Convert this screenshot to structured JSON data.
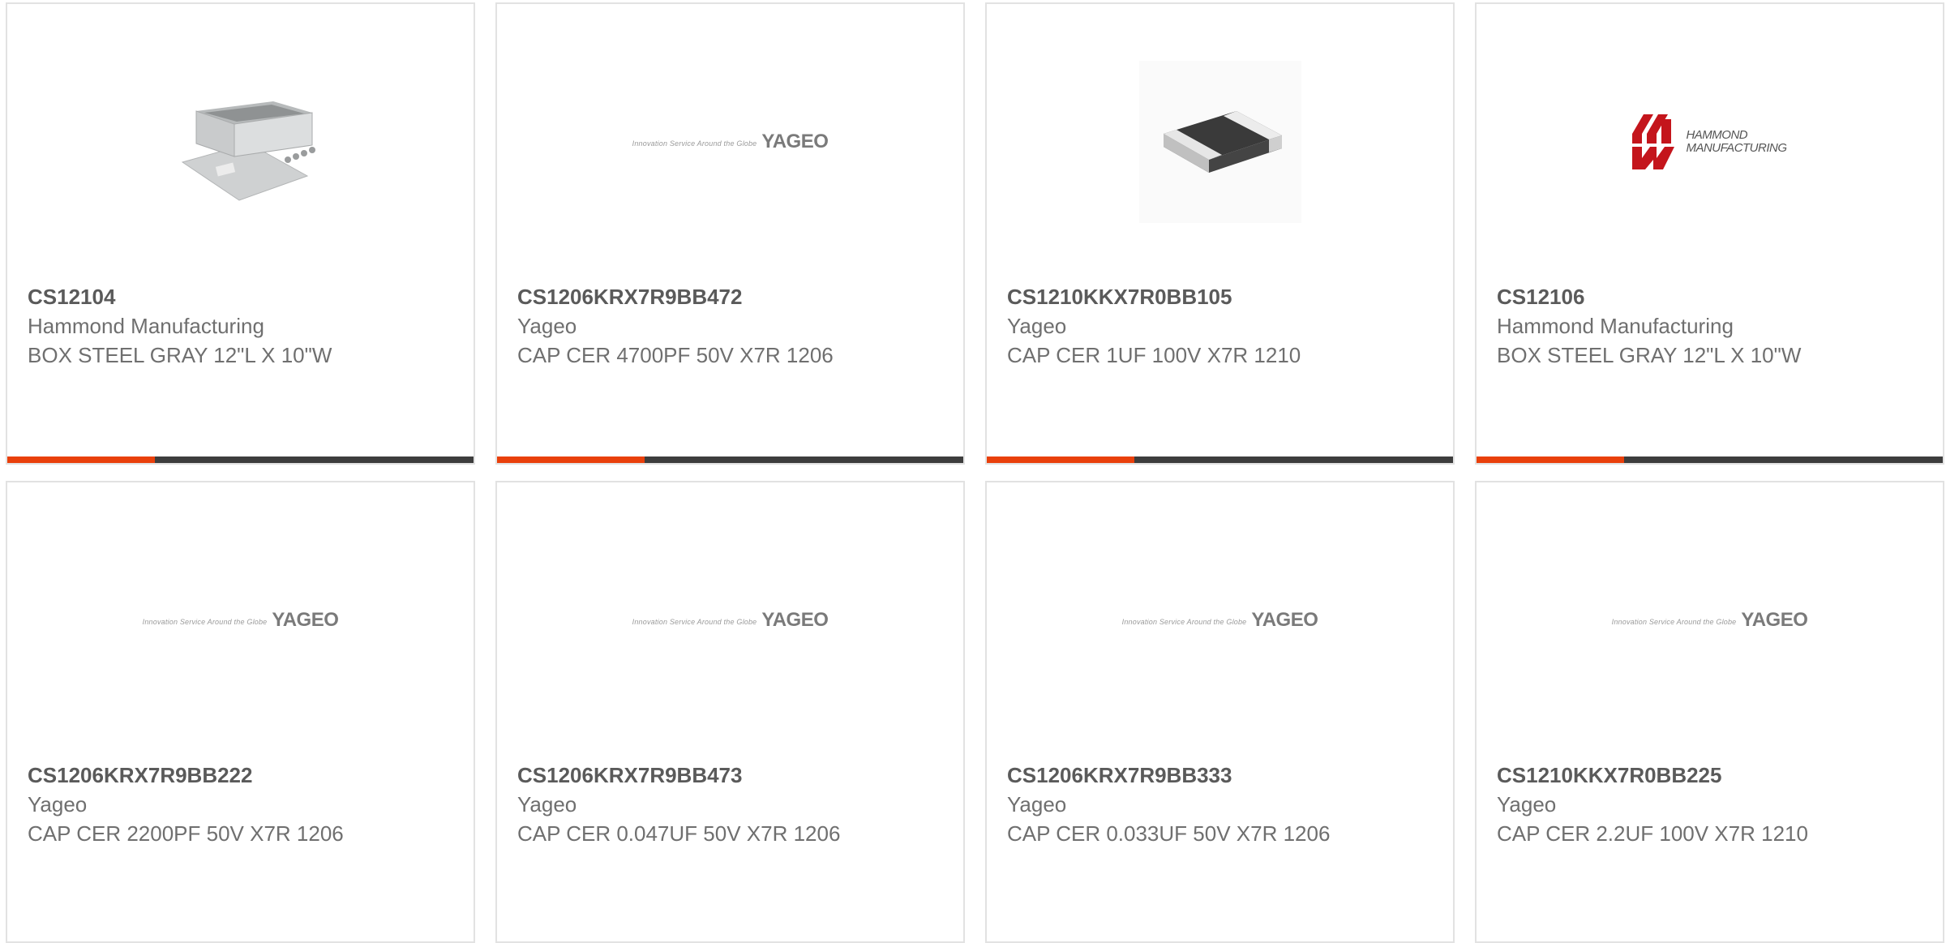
{
  "products": [
    {
      "part_number": "CS12104",
      "manufacturer": "Hammond Manufacturing",
      "description": "BOX STEEL GRAY 12\"L X 10\"W",
      "image": "steel-box-enclosure-image"
    },
    {
      "part_number": "CS1206KRX7R9BB472",
      "manufacturer": "Yageo",
      "description": "CAP CER 4700PF 50V X7R 1206",
      "image": "yageo-logo"
    },
    {
      "part_number": "CS1210KKX7R0BB105",
      "manufacturer": "Yageo",
      "description": "CAP CER 1UF 100V X7R 1210",
      "image": "ceramic-capacitor-chip-image"
    },
    {
      "part_number": "CS12106",
      "manufacturer": "Hammond Manufacturing",
      "description": "BOX STEEL GRAY 12\"L X 10\"W",
      "image": "hammond-logo"
    },
    {
      "part_number": "CS1206KRX7R9BB222",
      "manufacturer": "Yageo",
      "description": "CAP CER 2200PF 50V X7R 1206",
      "image": "yageo-logo"
    },
    {
      "part_number": "CS1206KRX7R9BB473",
      "manufacturer": "Yageo",
      "description": "CAP CER 0.047UF 50V X7R 1206",
      "image": "yageo-logo"
    },
    {
      "part_number": "CS1206KRX7R9BB333",
      "manufacturer": "Yageo",
      "description": "CAP CER 0.033UF 50V X7R 1206",
      "image": "yageo-logo"
    },
    {
      "part_number": "CS1210KKX7R0BB225",
      "manufacturer": "Yageo",
      "description": "CAP CER 2.2UF 100V X7R 1210",
      "image": "yageo-logo"
    }
  ],
  "logos": {
    "yageo_word": "YAGEO",
    "yageo_tagline": "Innovation Service Around the Globe",
    "hammond_line1": "HAMMOND",
    "hammond_line2": "MANUFACTURING"
  },
  "colors": {
    "accent": "#e9400b",
    "bar": "#3d3d3d",
    "card_border": "#e2e2e2",
    "text": "#6f6f6f"
  }
}
